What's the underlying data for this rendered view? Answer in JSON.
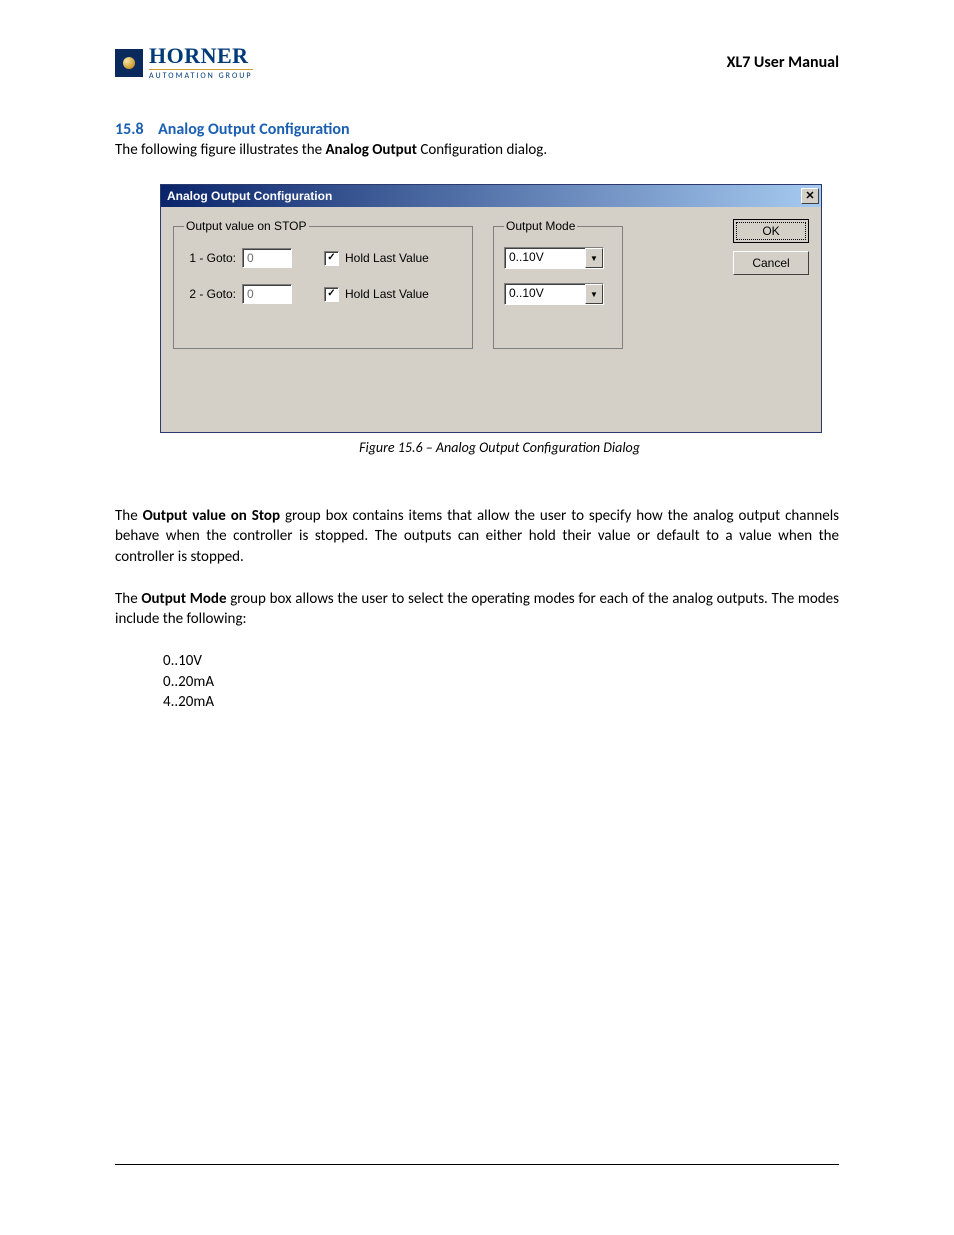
{
  "header": {
    "logo_main": "HORNER",
    "logo_sub": "AUTOMATION GROUP",
    "doc_title": "XL7 User Manual"
  },
  "section": {
    "number": "15.8",
    "title": "Analog Output Configuration",
    "intro_pre": "The following figure illustrates the ",
    "intro_bold": "Analog Output",
    "intro_post": " Configuration dialog."
  },
  "dialog": {
    "title": "Analog Output Configuration",
    "close_glyph": "✕",
    "stop_group": {
      "legend": "Output value on STOP",
      "rows": [
        {
          "label": "1 - Goto:",
          "value": "0",
          "hold_checked": true,
          "hold_label": "Hold Last Value"
        },
        {
          "label": "2 - Goto:",
          "value": "0",
          "hold_checked": true,
          "hold_label": "Hold Last Value"
        }
      ]
    },
    "mode_group": {
      "legend": "Output Mode",
      "combos": [
        {
          "value": "0..10V"
        },
        {
          "value": "0..10V"
        }
      ]
    },
    "buttons": {
      "ok": "OK",
      "cancel": "Cancel"
    }
  },
  "caption": "Figure 15.6 – Analog Output Configuration Dialog",
  "body": {
    "p1_pre": "The ",
    "p1_bold": "Output value on Stop",
    "p1_post": " group box contains items that allow the user to specify how the analog output channels behave when the controller is stopped. The outputs can either hold their value or default to a value when the controller is stopped.",
    "p2_pre": "The ",
    "p2_bold": "Output Mode",
    "p2_post_a": " group box allows the user to select the operating modes for each of the analog outputs.",
    "p2_post_b": " The modes include the following:",
    "modes": [
      "0..10V",
      "0..20mA",
      "4..20mA"
    ]
  }
}
